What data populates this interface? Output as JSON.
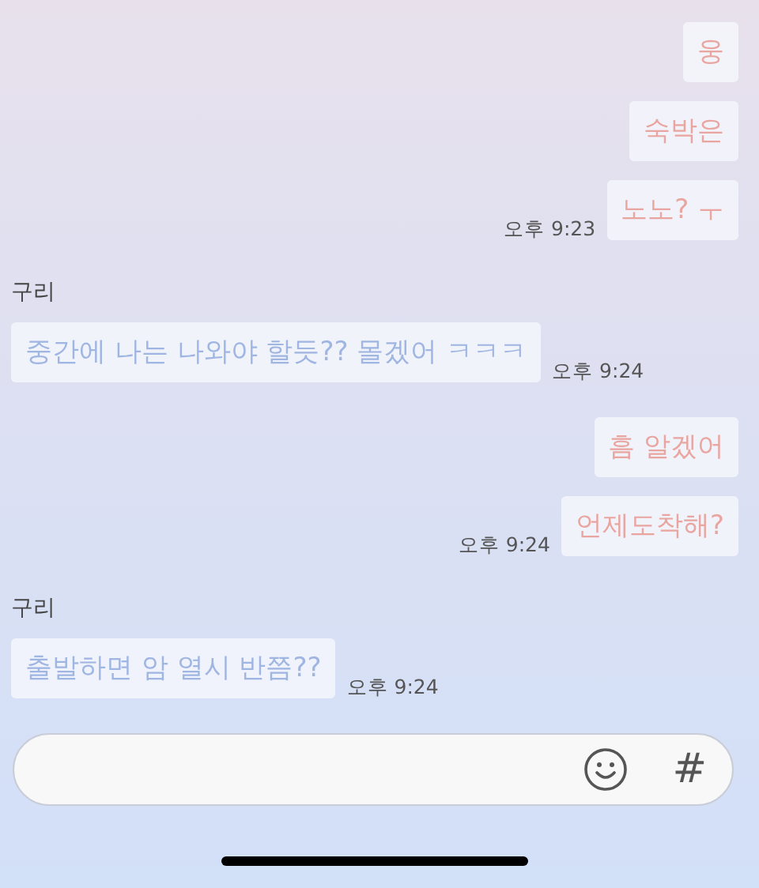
{
  "groups": [
    {
      "kind": "sent",
      "messages": [
        {
          "text": "웅"
        },
        {
          "text": "숙박은"
        },
        {
          "text": "노노? ㅜ",
          "time": "오후 9:23"
        }
      ]
    },
    {
      "kind": "received",
      "sender": "구리",
      "messages": [
        {
          "text": "중간에 나는 나와야 할듯?? 몰겠어 ㅋㅋㅋ",
          "time": "오후 9:24"
        }
      ]
    },
    {
      "kind": "sent",
      "messages": [
        {
          "text": "흠 알겠어"
        },
        {
          "text": "언제도착해?",
          "time": "오후 9:24"
        }
      ]
    },
    {
      "kind": "received",
      "sender": "구리",
      "messages": [
        {
          "text": "출발하면 암 열시 반쯤??",
          "time": "오후 9:24"
        }
      ]
    }
  ],
  "composer": {
    "hash_key": "#"
  }
}
